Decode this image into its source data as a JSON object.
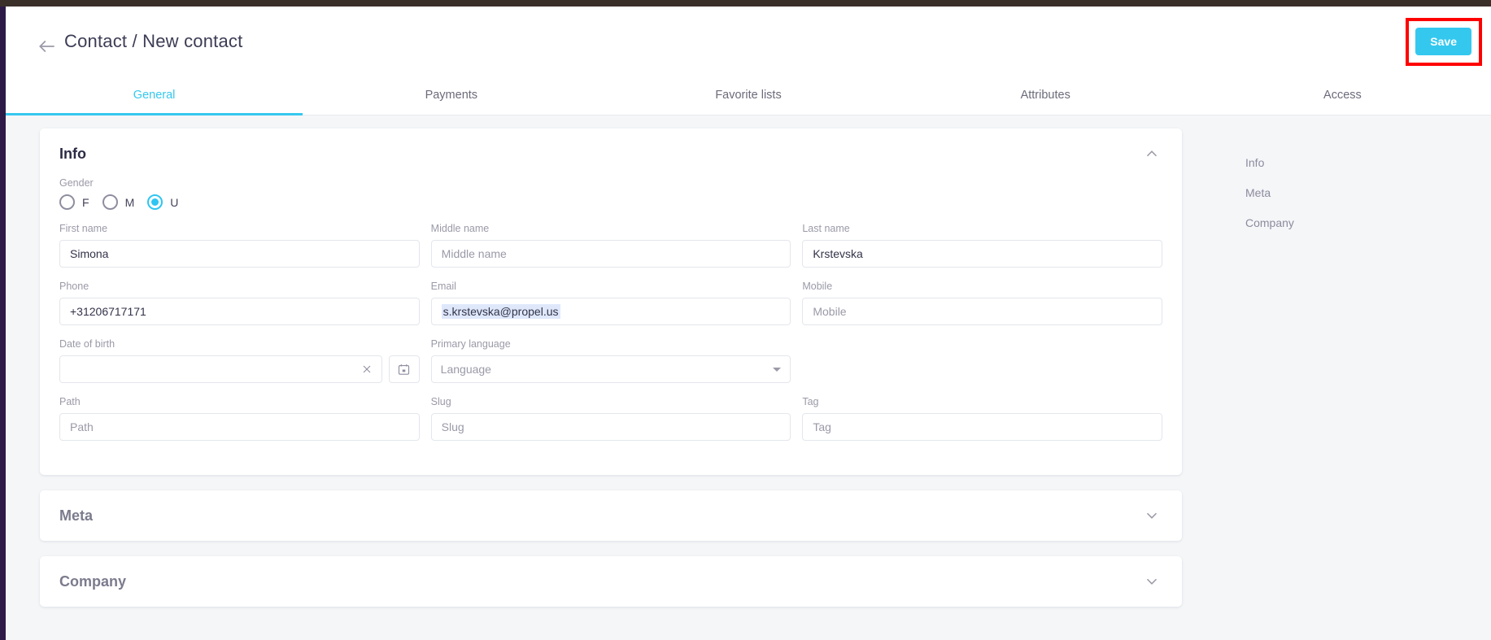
{
  "header": {
    "title": "Contact / New contact",
    "back_icon": "arrow-left-icon",
    "save_label": "Save",
    "annotation_color": "#fe0000",
    "accent_color": "#35c8ef"
  },
  "tabs": [
    {
      "label": "General",
      "active": true
    },
    {
      "label": "Payments",
      "active": false
    },
    {
      "label": "Favorite lists",
      "active": false
    },
    {
      "label": "Attributes",
      "active": false
    },
    {
      "label": "Access",
      "active": false
    }
  ],
  "info_card": {
    "title": "Info",
    "collapse_icon": "chevron-up-icon",
    "gender": {
      "label": "Gender",
      "options": [
        {
          "label": "F",
          "selected": false
        },
        {
          "label": "M",
          "selected": false
        },
        {
          "label": "U",
          "selected": true
        }
      ]
    },
    "fields": {
      "first_name": {
        "label": "First name",
        "value": "Simona",
        "placeholder": "First name"
      },
      "middle_name": {
        "label": "Middle name",
        "value": "",
        "placeholder": "Middle name"
      },
      "last_name": {
        "label": "Last name",
        "value": "Krstevska",
        "placeholder": "Last name"
      },
      "phone": {
        "label": "Phone",
        "value": "+31206717171",
        "placeholder": "Phone"
      },
      "email": {
        "label": "Email",
        "value": "s.krstevska@propel.us",
        "placeholder": "Email",
        "selected": true
      },
      "mobile": {
        "label": "Mobile",
        "value": "",
        "placeholder": "Mobile"
      },
      "date_of_birth": {
        "label": "Date of birth",
        "value": "",
        "placeholder": "",
        "clear_icon": "close-icon",
        "calendar_icon": "calendar-icon"
      },
      "primary_language": {
        "label": "Primary language",
        "value": "Language",
        "placeholder": "Language",
        "caret_icon": "chevron-down-icon"
      },
      "path": {
        "label": "Path",
        "value": "",
        "placeholder": "Path"
      },
      "slug": {
        "label": "Slug",
        "value": "",
        "placeholder": "Slug"
      },
      "tag": {
        "label": "Tag",
        "value": "",
        "placeholder": "Tag"
      }
    }
  },
  "meta_card": {
    "title": "Meta",
    "expand_icon": "chevron-down-icon"
  },
  "company_card": {
    "title": "Company",
    "expand_icon": "chevron-down-icon"
  },
  "sidebar": {
    "items": [
      {
        "label": "Info"
      },
      {
        "label": "Meta"
      },
      {
        "label": "Company"
      }
    ]
  }
}
